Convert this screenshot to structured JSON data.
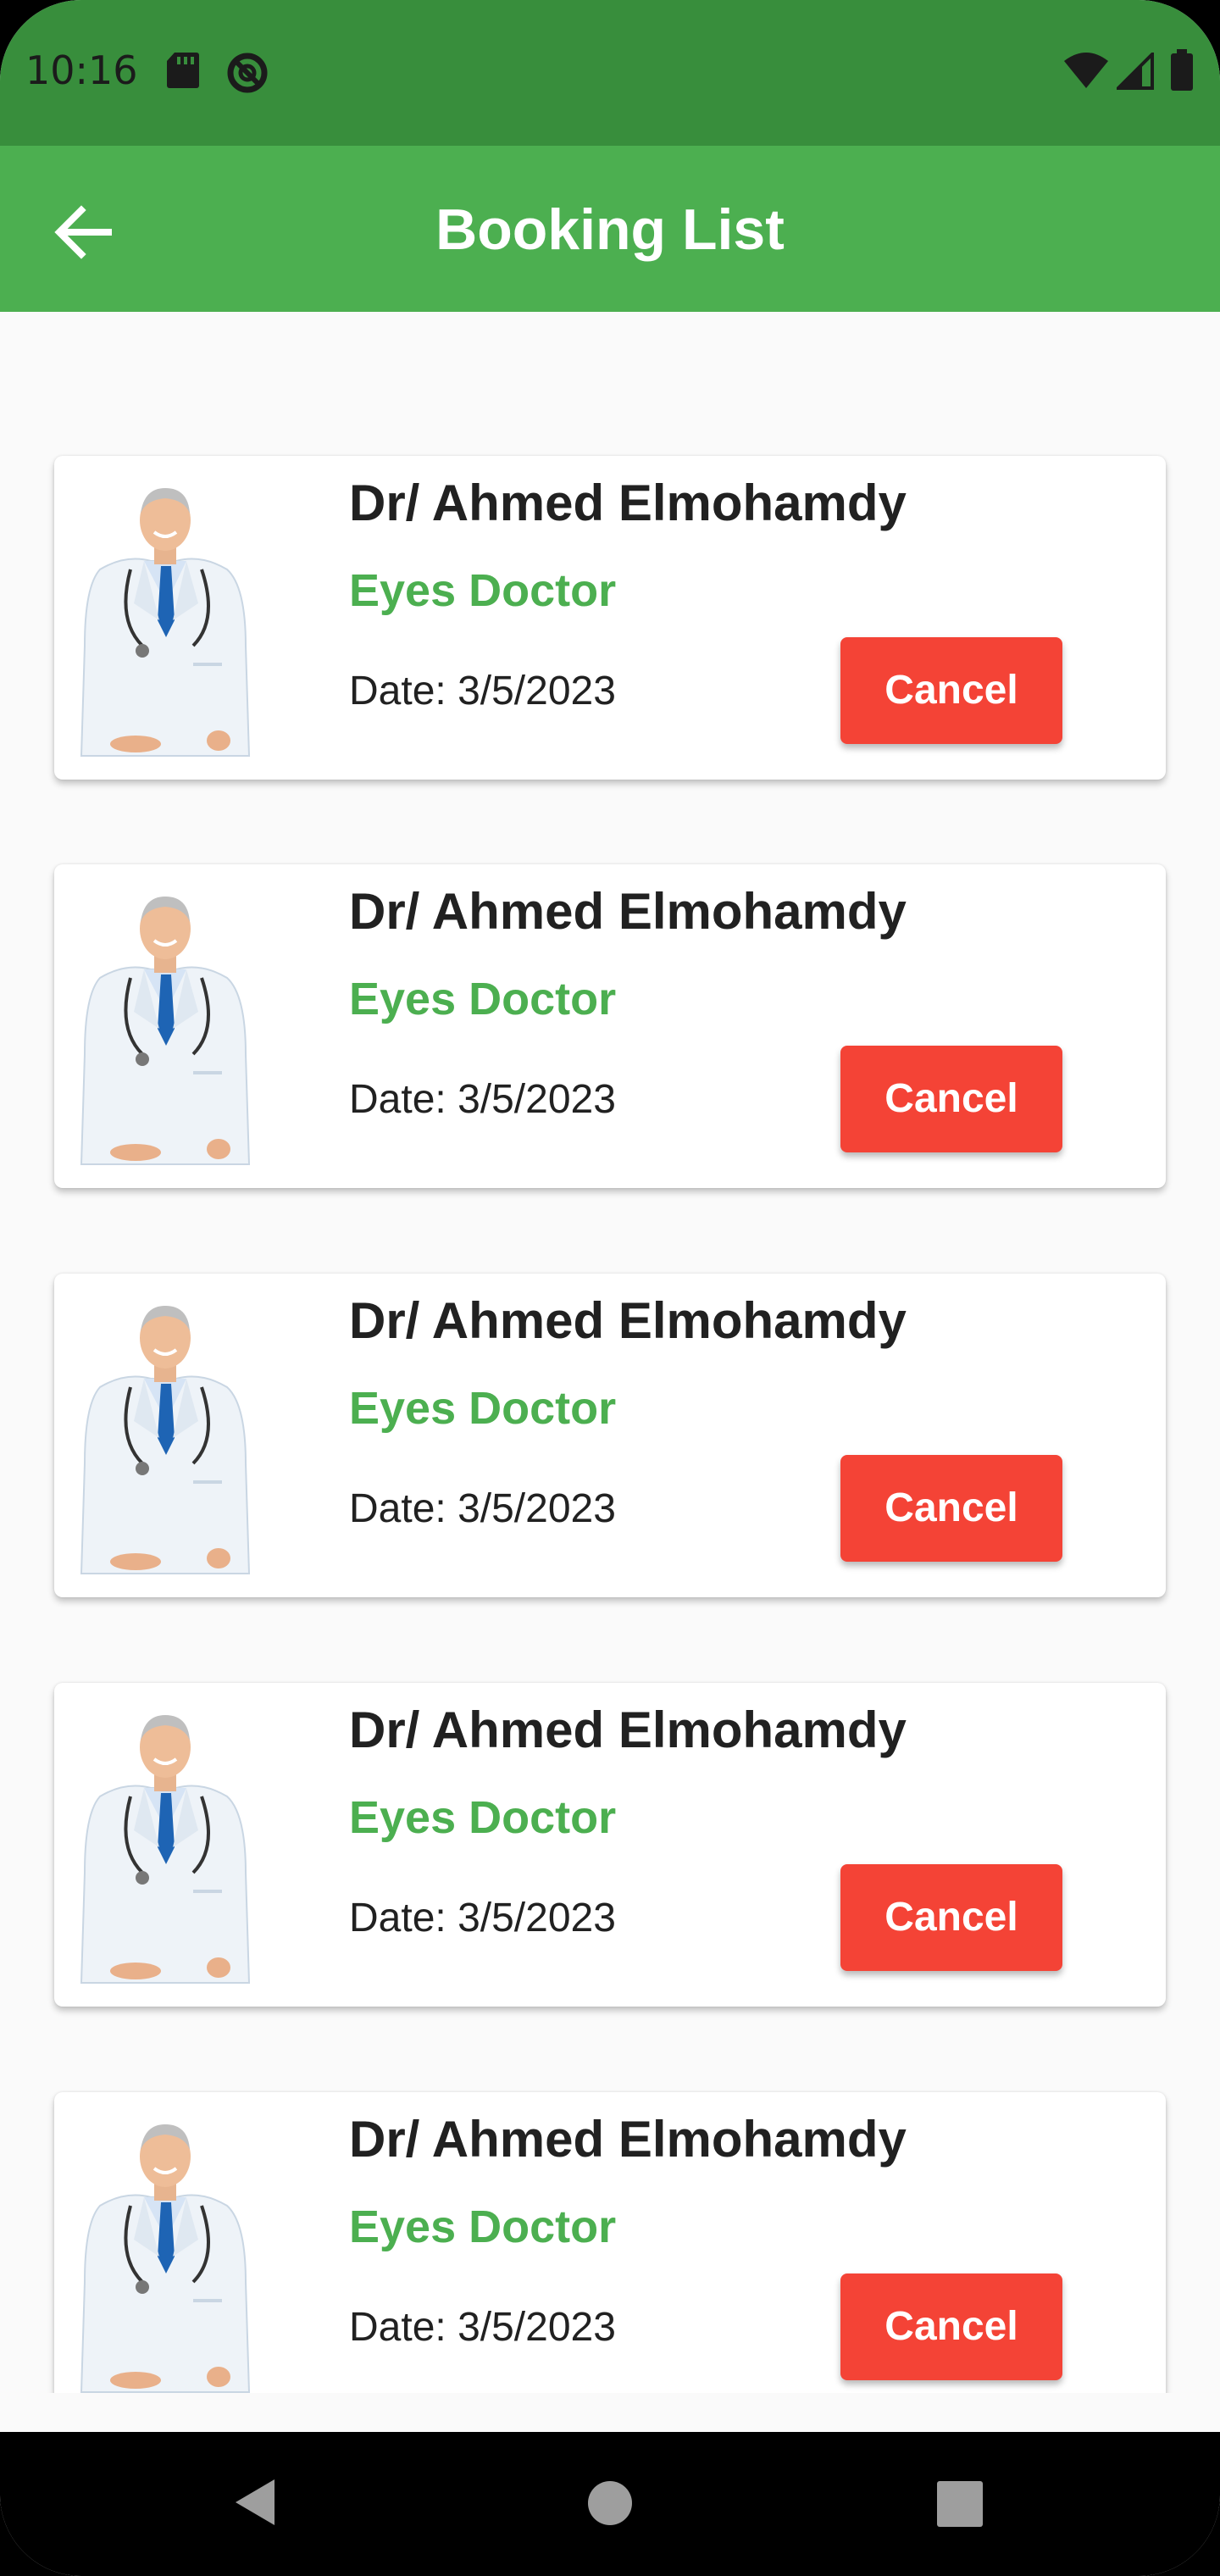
{
  "status_bar": {
    "time": "10:16",
    "icons": [
      "sd-card-icon",
      "no-disturb-icon",
      "wifi-icon",
      "signal-icon",
      "battery-icon"
    ]
  },
  "app_bar": {
    "title": "Booking List",
    "back_icon": "arrow-back-icon"
  },
  "bookings": [
    {
      "name": "Dr/ Ahmed Elmohamdy",
      "specialty": "Eyes Doctor",
      "date": "Date: 3/5/2023",
      "cancel_label": "Cancel"
    },
    {
      "name": "Dr/ Ahmed Elmohamdy",
      "specialty": "Eyes Doctor",
      "date": "Date: 3/5/2023",
      "cancel_label": "Cancel"
    },
    {
      "name": "Dr/ Ahmed Elmohamdy",
      "specialty": "Eyes Doctor",
      "date": "Date: 3/5/2023",
      "cancel_label": "Cancel"
    },
    {
      "name": "Dr/ Ahmed Elmohamdy",
      "specialty": "Eyes Doctor",
      "date": "Date: 3/5/2023",
      "cancel_label": "Cancel"
    },
    {
      "name": "Dr/ Ahmed Elmohamdy",
      "specialty": "Eyes Doctor",
      "date": "Date: 3/5/2023",
      "cancel_label": "Cancel"
    }
  ],
  "nav_bar": {
    "icons": [
      "nav-back-icon",
      "nav-home-icon",
      "nav-recents-icon"
    ]
  },
  "colors": {
    "status_bar": "#388e3c",
    "app_bar": "#4caf50",
    "specialty_text": "#4caf50",
    "cancel_button": "#f44336",
    "background": "#fafafa"
  }
}
